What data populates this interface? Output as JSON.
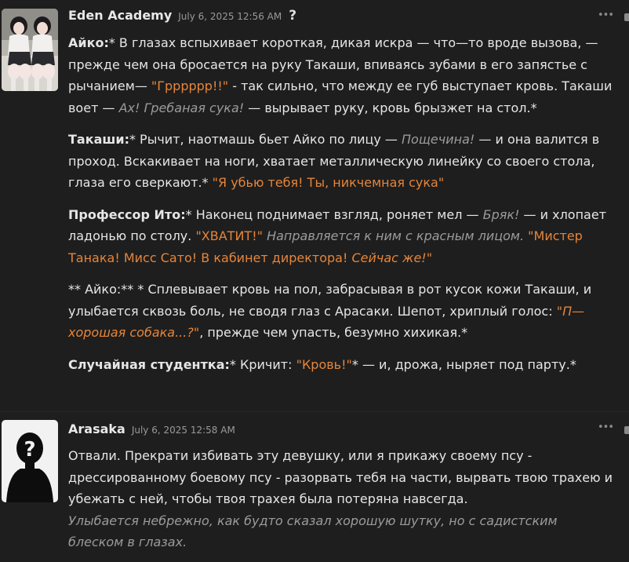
{
  "messages": [
    {
      "author": "Eden Academy",
      "time": "July 6, 2025 12:56 AM",
      "help_glyph": "?",
      "more_glyph": "•••",
      "avatar_icon": "anime-character-avatar",
      "p1": {
        "speaker": "Айко:",
        "t1": "* В глазах вспыхивает короткая, дикая искра — что—то вроде вызова, — прежде чем она бросается на руку Такаши, впиваясь зубами в его запястье с рычанием— ",
        "q1": "\"Грррррр!!\"",
        "t2": " - так сильно, что между ее губ выступает кровь. Такаши воет — ",
        "i1": "Ах! Гребаная сука!",
        "t3": " — вырывает руку, кровь брызжет на стол.*"
      },
      "p2": {
        "speaker": "Такаши:",
        "t1": "* Рычит, наотмашь бьет Айко по лицу — ",
        "i1": "Пощечина!",
        "t2": " — и она валится в проход. Вскакивает на ноги, хватает металлическую линейку со своего стола, глаза его сверкают.* ",
        "q1": "\"Я убью тебя! Ты, никчемная сука\""
      },
      "p3": {
        "speaker": "Профессор Ито:",
        "t1": "* Наконец поднимает взгляд, роняет мел — ",
        "i1": "Бряк!",
        "t2": " — и хлопает ладонью по столу. ",
        "q1": "\"ХВАТИТ!\"",
        "t3": " ",
        "i2": "Направляется к ним с красным лицом.",
        "t4": " ",
        "q2": "\"Мистер Танака! Мисс Сато! В кабинет директора! ",
        "qi1": "Сейчас же!",
        "q3": "\""
      },
      "p4": {
        "t1": "** Айко:** * Сплевывает кровь на пол, забрасывая в рот кусок кожи Такаши, и улыбается сквозь боль, не сводя глаз с Арасаки. Шепот, хриплый голос: ",
        "qi1": "\"П—хорошая собака...?\"",
        "t2": ", прежде чем упасть, безумно хихикая.*"
      },
      "p5": {
        "speaker": "Случайная студентка:",
        "t1": "* Кричит: ",
        "q1": "\"Кровь!\"",
        "t2": "* — и, дрожа, ныряет под парту.*"
      }
    },
    {
      "author": "Arasaka",
      "time": "July 6, 2025 12:58 AM",
      "more_glyph": "•••",
      "avatar_icon": "default-user-silhouette-icon",
      "p1": {
        "t1": "Отвали. Прекрати избивать эту девушку, или я прикажу своему псу - дрессированному боевому псу - разорвать тебя на части, вырвать твою трахею и убежать с ней, чтобы твоя трахея была потеряна навсегда.",
        "i1": "Улыбается небрежно, как будто сказал хорошую шутку, но с садистским блеском в глазах."
      }
    }
  ]
}
